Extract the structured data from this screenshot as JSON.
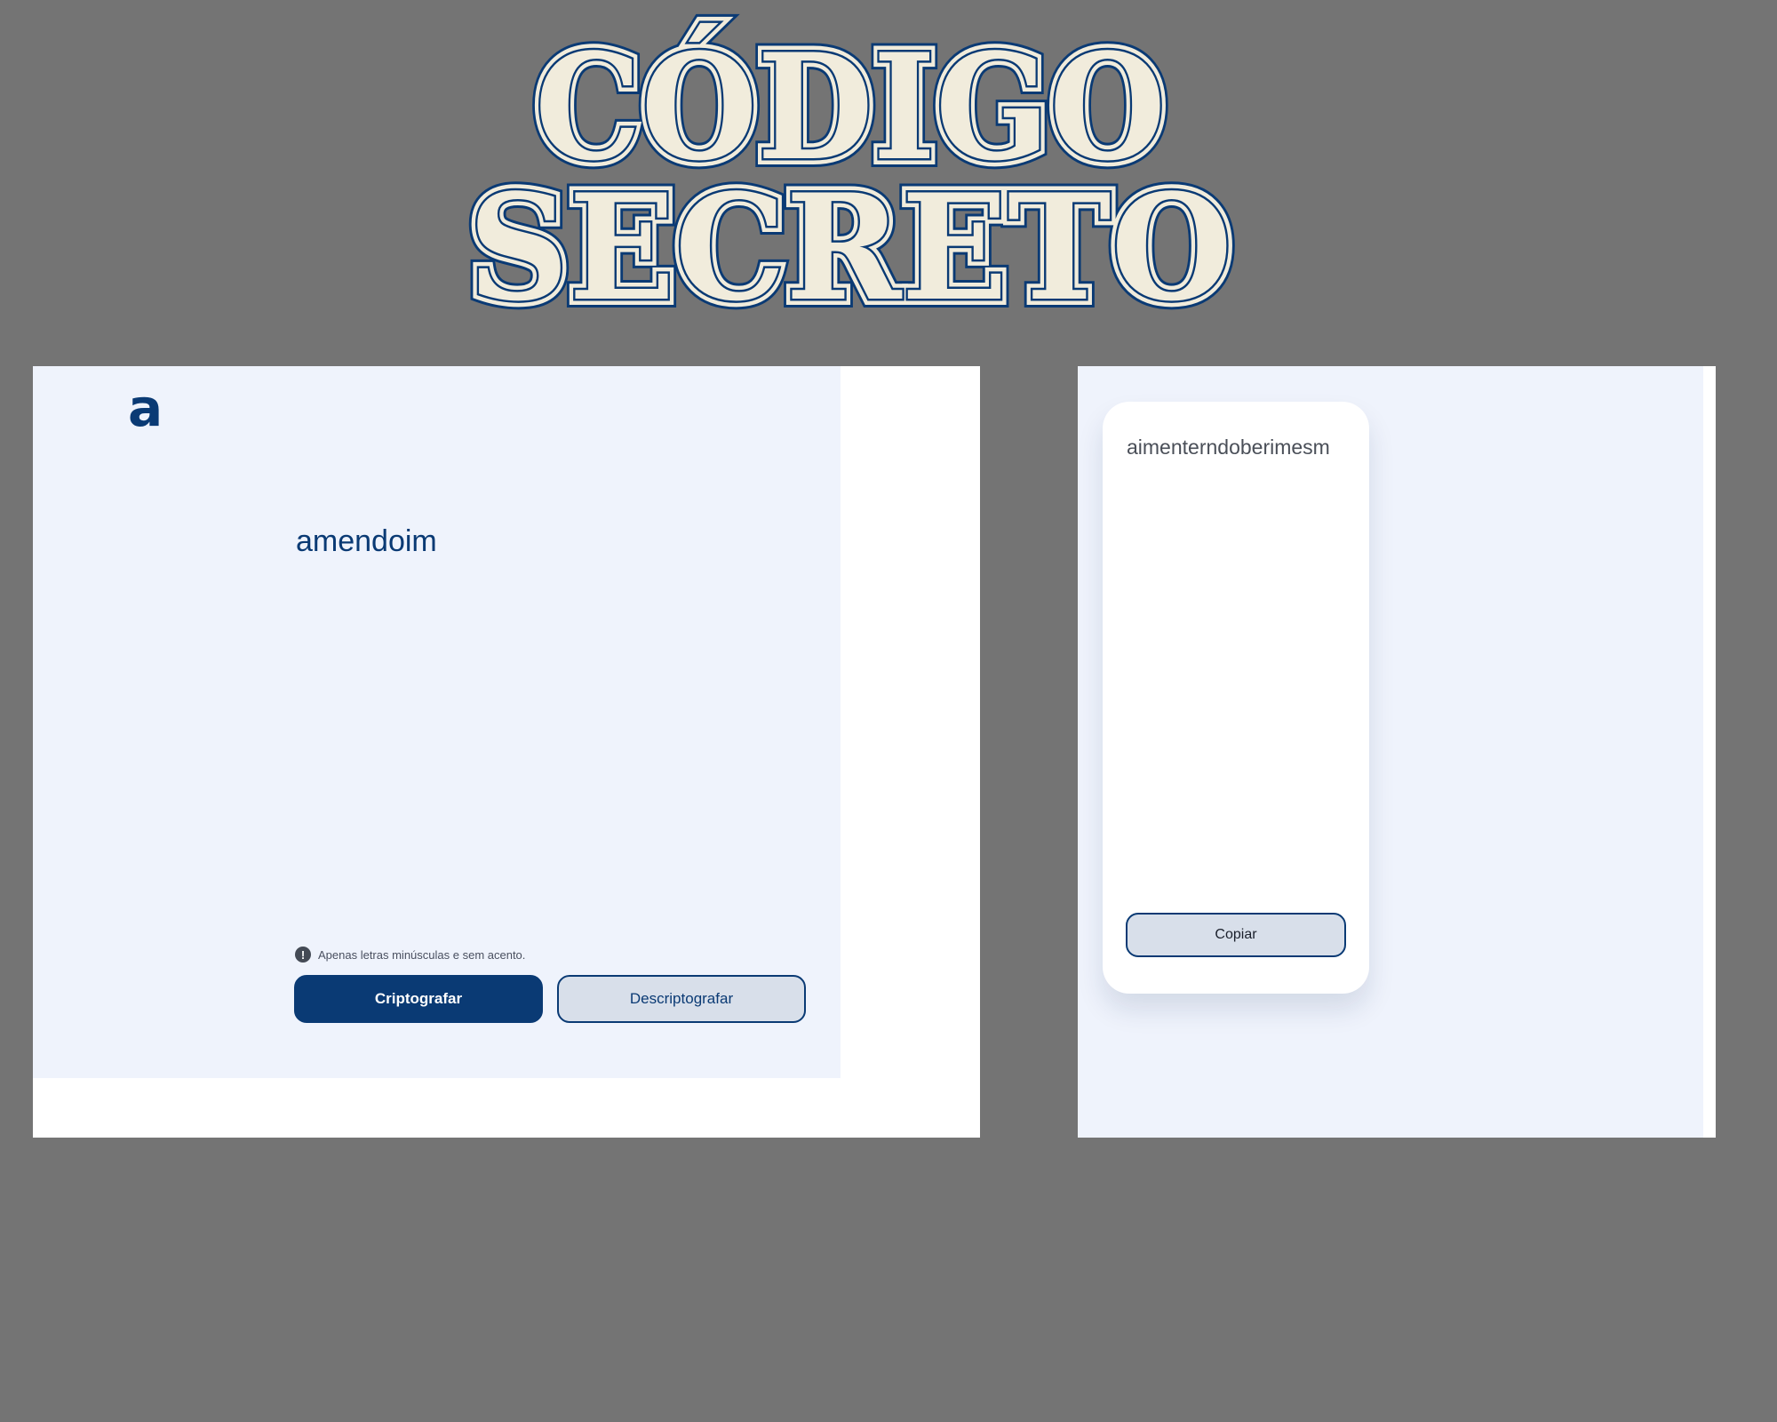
{
  "banner": {
    "line1": "CÓDIGO",
    "line2": "SECRETO"
  },
  "left_panel": {
    "logo": "a",
    "input_value": "amendoim",
    "hint_icon": "!",
    "hint_text": "Apenas letras minúsculas e sem acento.",
    "encrypt_label": "Criptografar",
    "decrypt_label": "Descriptografar"
  },
  "right_panel": {
    "output_value": "aimenterndoberimesm",
    "copy_label": "Copiar"
  },
  "colors": {
    "background": "#747474",
    "brand": "#0a3a74",
    "panel": "#eff3fc",
    "title_fill": "#f1ecdc"
  },
  "icons": {
    "hint": "exclamation-circle-icon",
    "logo": "alura-logo"
  }
}
